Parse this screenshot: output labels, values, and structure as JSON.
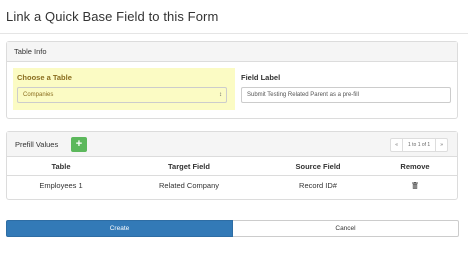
{
  "dialog": {
    "title": "Link a Quick Base Field to this Form"
  },
  "table_info": {
    "header": "Table Info",
    "choose_label": "Choose a Table",
    "selected_table": "Companies",
    "field_label": "Field Label",
    "field_label_value": "Submit Testing Related Parent as a pre-fill"
  },
  "prefill": {
    "header": "Prefill Values",
    "add_label": "+",
    "pager": {
      "prev": "«",
      "page_text": "1 to 1 of 1",
      "next": "»"
    },
    "columns": [
      "Table",
      "Target Field",
      "Source Field",
      "Remove"
    ],
    "rows": [
      {
        "table": "Employees 1",
        "target_field": "Related Company",
        "source_field": "Record ID#"
      }
    ]
  },
  "actions": {
    "create": "Create",
    "cancel": "Cancel"
  },
  "colors": {
    "primary": "#337ab7",
    "success": "#5cb85c",
    "highlight": "#fbfbc4"
  }
}
